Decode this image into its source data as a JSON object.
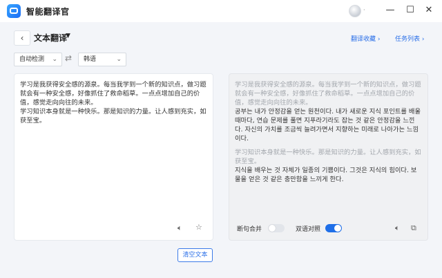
{
  "app": {
    "title": "智能翻译官"
  },
  "window": {
    "minimize": "—",
    "maximize": "☐",
    "close": "✕"
  },
  "toolbar": {
    "back": "‹",
    "mode": "文本翻译",
    "mode_caret": "▼",
    "links": [
      "翻译收藏 ›",
      "任务列表 ›"
    ]
  },
  "languages": {
    "source": "自动检测",
    "target": "韩语",
    "swap": "⇄"
  },
  "source_panel": {
    "paragraphs": [
      "学习是我获得安全感的源泉。每当我学到一个新的知识点，做习题就会有一种安全感，好像抓住了救命稻草。一点点增加自己的价值，感觉走向向往的未来。",
      "学习知识本身就是一种快乐。那是知识的力量。让人感到充实，如获至宝。"
    ]
  },
  "result_panel": {
    "pairs": [
      {
        "source": "学习是我获得安全感的源泉。每当我学到一个新的知识点，做习题就会有一种安全感，好像抓住了救命稻草。一点点增加自己的价值，感觉走向向往的未来。",
        "target": "공부는 내가 안정감을 얻는 원천이다. 내가 새로운 지식 포인트를 배울 때마다, 연습 문제를 풀면 지푸라기라도 잡는 것 같은 안정감을 느낀다. 자신의 가치를 조금씩 늘려가면서 지향하는 미래로 나아가는 느낌이다."
      },
      {
        "source": "学习知识本身就是一种快乐。那是知识的力量。让人感到充实，如获至宝。",
        "target": "지식을 배우는 것 자체가 일종의 기쁨이다. 그것은 지식의 힘이다. 보물을 얻은 것 같은 충만함을 느끼게 한다."
      }
    ],
    "sentence_merge_label": "断句合并",
    "sentence_merge_on": false,
    "bilingual_label": "双语对照",
    "bilingual_on": true
  },
  "clear_button": "清空文本",
  "icons": [
    "app-logo-icon",
    "back-icon",
    "swap-icon",
    "speaker-icon",
    "star-icon",
    "copy-icon"
  ]
}
